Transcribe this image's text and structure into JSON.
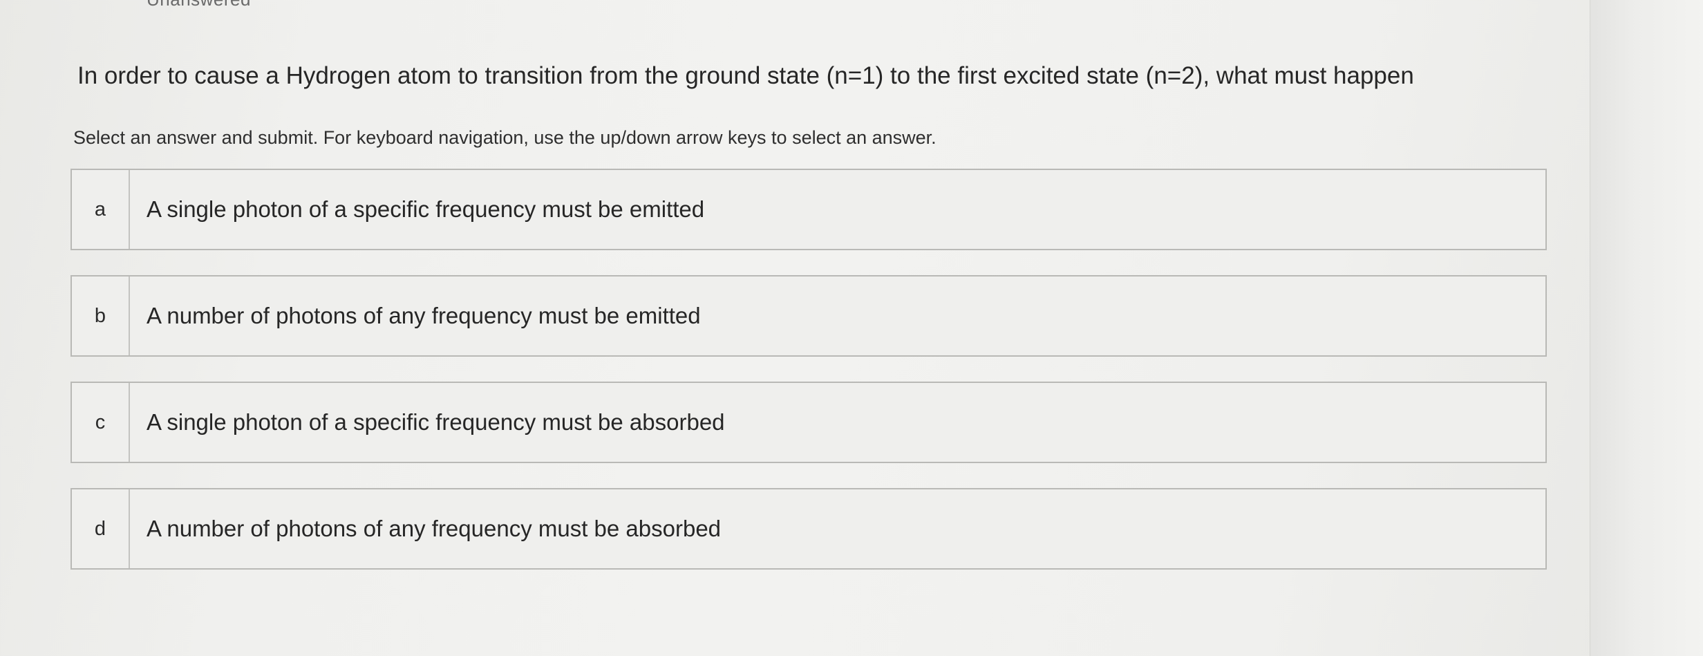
{
  "status_label": "Unanswered",
  "question": "In order to cause a Hydrogen atom to transition from the ground state (n=1) to the first excited state (n=2), what must happen",
  "instructions": "Select an answer and submit. For keyboard navigation, use the up/down arrow keys to select an answer.",
  "options": [
    {
      "letter": "a",
      "text": "A single photon of a specific frequency must be emitted"
    },
    {
      "letter": "b",
      "text": "A number of photons of any frequency must be emitted"
    },
    {
      "letter": "c",
      "text": "A single photon of a specific frequency must be absorbed"
    },
    {
      "letter": "d",
      "text": "A number of photons of any frequency must be absorbed"
    }
  ]
}
